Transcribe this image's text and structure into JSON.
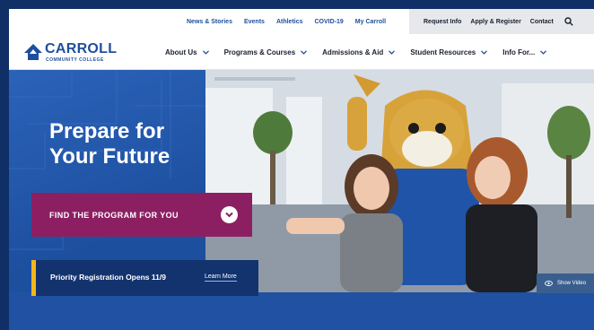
{
  "utility_nav": {
    "links": [
      "News & Stories",
      "Events",
      "Athletics",
      "COVID-19",
      "My Carroll"
    ],
    "right_links": [
      "Request Info",
      "Apply & Register",
      "Contact"
    ],
    "search_icon": "search-icon"
  },
  "brand": {
    "name": "CARROLL",
    "subtitle": "COMMUNITY COLLEGE",
    "primary_color": "#1f4f9c",
    "accent_color": "#8c1f62",
    "highlight_color": "#f2b71c"
  },
  "main_nav": {
    "items": [
      {
        "label": "About Us"
      },
      {
        "label": "Programs & Courses"
      },
      {
        "label": "Admissions & Aid"
      },
      {
        "label": "Student Resources"
      },
      {
        "label": "Info For..."
      }
    ],
    "chevron_icon": "chevron-down-icon"
  },
  "hero": {
    "headline_line1": "Prepare for",
    "headline_line2": "Your Future",
    "cta_label": "FIND THE PROGRAM FOR YOU",
    "notice_text": "Priority Registration Opens 11/9",
    "notice_link": "Learn More",
    "video_label": "Show Video"
  }
}
